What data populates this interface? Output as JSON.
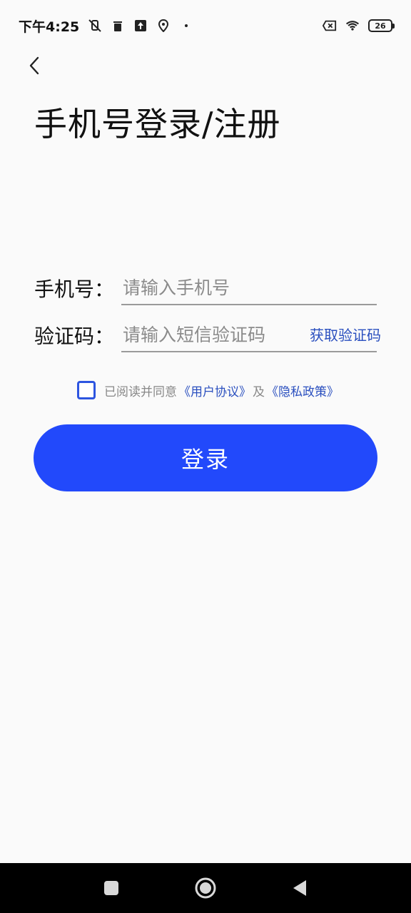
{
  "status_bar": {
    "time": "下午4:25",
    "battery_level": "26",
    "icons": [
      "mute-vibrate-icon",
      "trash-icon",
      "upload-icon",
      "location-icon",
      "dot-icon",
      "sim-x-icon",
      "wifi-icon",
      "battery-icon"
    ]
  },
  "header": {
    "back_icon": "chevron-left-icon",
    "title": "手机号登录/注册"
  },
  "form": {
    "phone_label": "手机号：",
    "phone_placeholder": "请输入手机号",
    "phone_value": "",
    "code_label": "验证码：",
    "code_placeholder": "请输入短信验证码",
    "code_value": "",
    "get_code_label": "获取验证码"
  },
  "agreement": {
    "checked": false,
    "prefix": "已阅读并同意",
    "user_agreement": "《用户协议》",
    "conjunction": "及",
    "privacy_policy": "《隐私政策》"
  },
  "login_button": {
    "label": "登录"
  },
  "colors": {
    "accent": "#2249fb",
    "link": "#2a4fbf",
    "background": "#fafafa"
  },
  "nav_bar": {
    "items": [
      "recents-square-icon",
      "home-circle-icon",
      "back-triangle-icon"
    ]
  }
}
